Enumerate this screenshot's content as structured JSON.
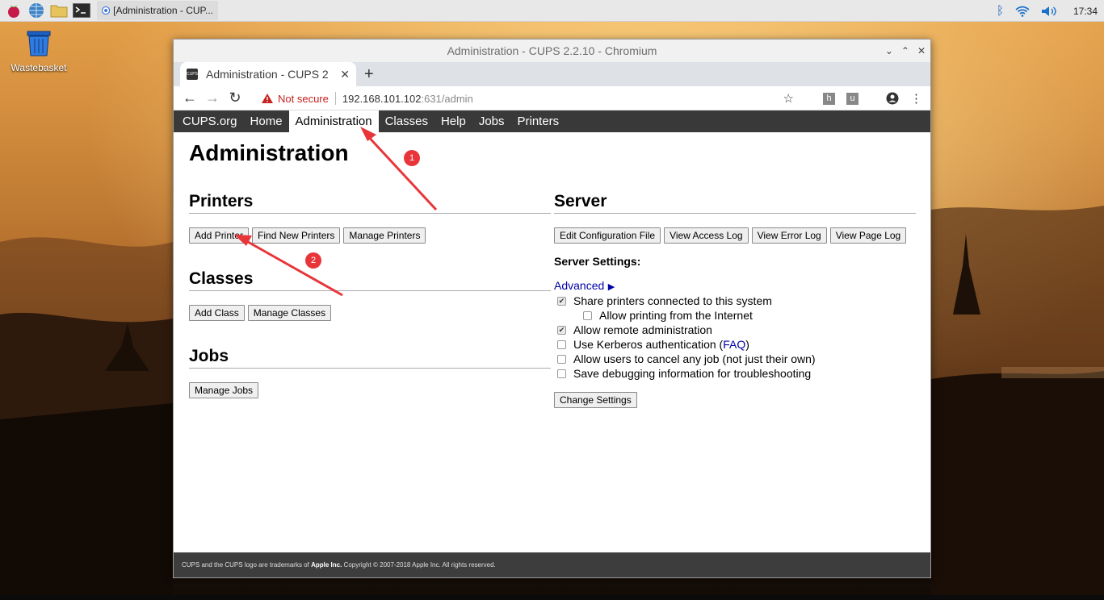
{
  "taskbar": {
    "task_label": "[Administration - CUP...",
    "clock": "17:34"
  },
  "desktop": {
    "trash_label": "Wastebasket"
  },
  "window": {
    "title": "Administration - CUPS 2.2.10 - Chromium",
    "tab_title": "Administration - CUPS 2",
    "favicon_text": "CUPS",
    "security_label": "Not secure",
    "url_host": "192.168.101.102",
    "url_rest": ":631/admin",
    "ext_h": "h",
    "ext_u": "u"
  },
  "nav": {
    "items": [
      "CUPS.org",
      "Home",
      "Administration",
      "Classes",
      "Help",
      "Jobs",
      "Printers"
    ],
    "active": "Administration"
  },
  "page": {
    "title": "Administration",
    "printers": {
      "heading": "Printers",
      "buttons": [
        "Add Printer",
        "Find New Printers",
        "Manage Printers"
      ]
    },
    "classes": {
      "heading": "Classes",
      "buttons": [
        "Add Class",
        "Manage Classes"
      ]
    },
    "jobs": {
      "heading": "Jobs",
      "buttons": [
        "Manage Jobs"
      ]
    },
    "server": {
      "heading": "Server",
      "buttons": [
        "Edit Configuration File",
        "View Access Log",
        "View Error Log",
        "View Page Log"
      ],
      "settings_label": "Server Settings:",
      "advanced_label": "Advanced",
      "advanced_arrow": "▶",
      "options": {
        "share": {
          "label": "Share printers connected to this system",
          "checked": true
        },
        "internet": {
          "label": "Allow printing from the Internet",
          "checked": false
        },
        "remote_admin": {
          "label": "Allow remote administration",
          "checked": true
        },
        "kerberos_prefix": "Use Kerberos authentication (",
        "kerberos_link": "FAQ",
        "kerberos_suffix": ")",
        "kerberos_checked": false,
        "cancel_any": {
          "label": "Allow users to cancel any job (not just their own)",
          "checked": false
        },
        "debug": {
          "label": "Save debugging information for troubleshooting",
          "checked": false
        }
      },
      "change_button": "Change Settings"
    },
    "footer": {
      "prefix": "CUPS and the CUPS logo are trademarks of ",
      "company": "Apple Inc.",
      "suffix": " Copyright © 2007-2018 Apple Inc. All rights reserved."
    }
  },
  "annotations": {
    "step1": "1",
    "step2": "2",
    "color": "#e8353a"
  }
}
